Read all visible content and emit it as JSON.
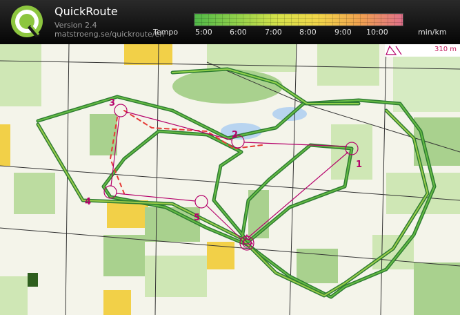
{
  "app": {
    "title": "QuickRoute",
    "version": "Version 2.4",
    "url": "matstroeng.se/quickroute/en"
  },
  "legend": {
    "label": "Tempo",
    "ticks": [
      "5:00",
      "6:00",
      "7:00",
      "8:00",
      "9:00",
      "10:00"
    ],
    "unit": "min/km",
    "colors": [
      "#50b848",
      "#8fd04a",
      "#d6e24a",
      "#f2d54a",
      "#f0a050",
      "#e0708a"
    ]
  },
  "map": {
    "scale_text": "310 m",
    "controls": [
      "1",
      "2",
      "3",
      "4",
      "5"
    ],
    "route_color": "#2e7d32",
    "fast_color": "#66bb44",
    "slow_color": "#e53935",
    "course_color": "#b5006a"
  }
}
